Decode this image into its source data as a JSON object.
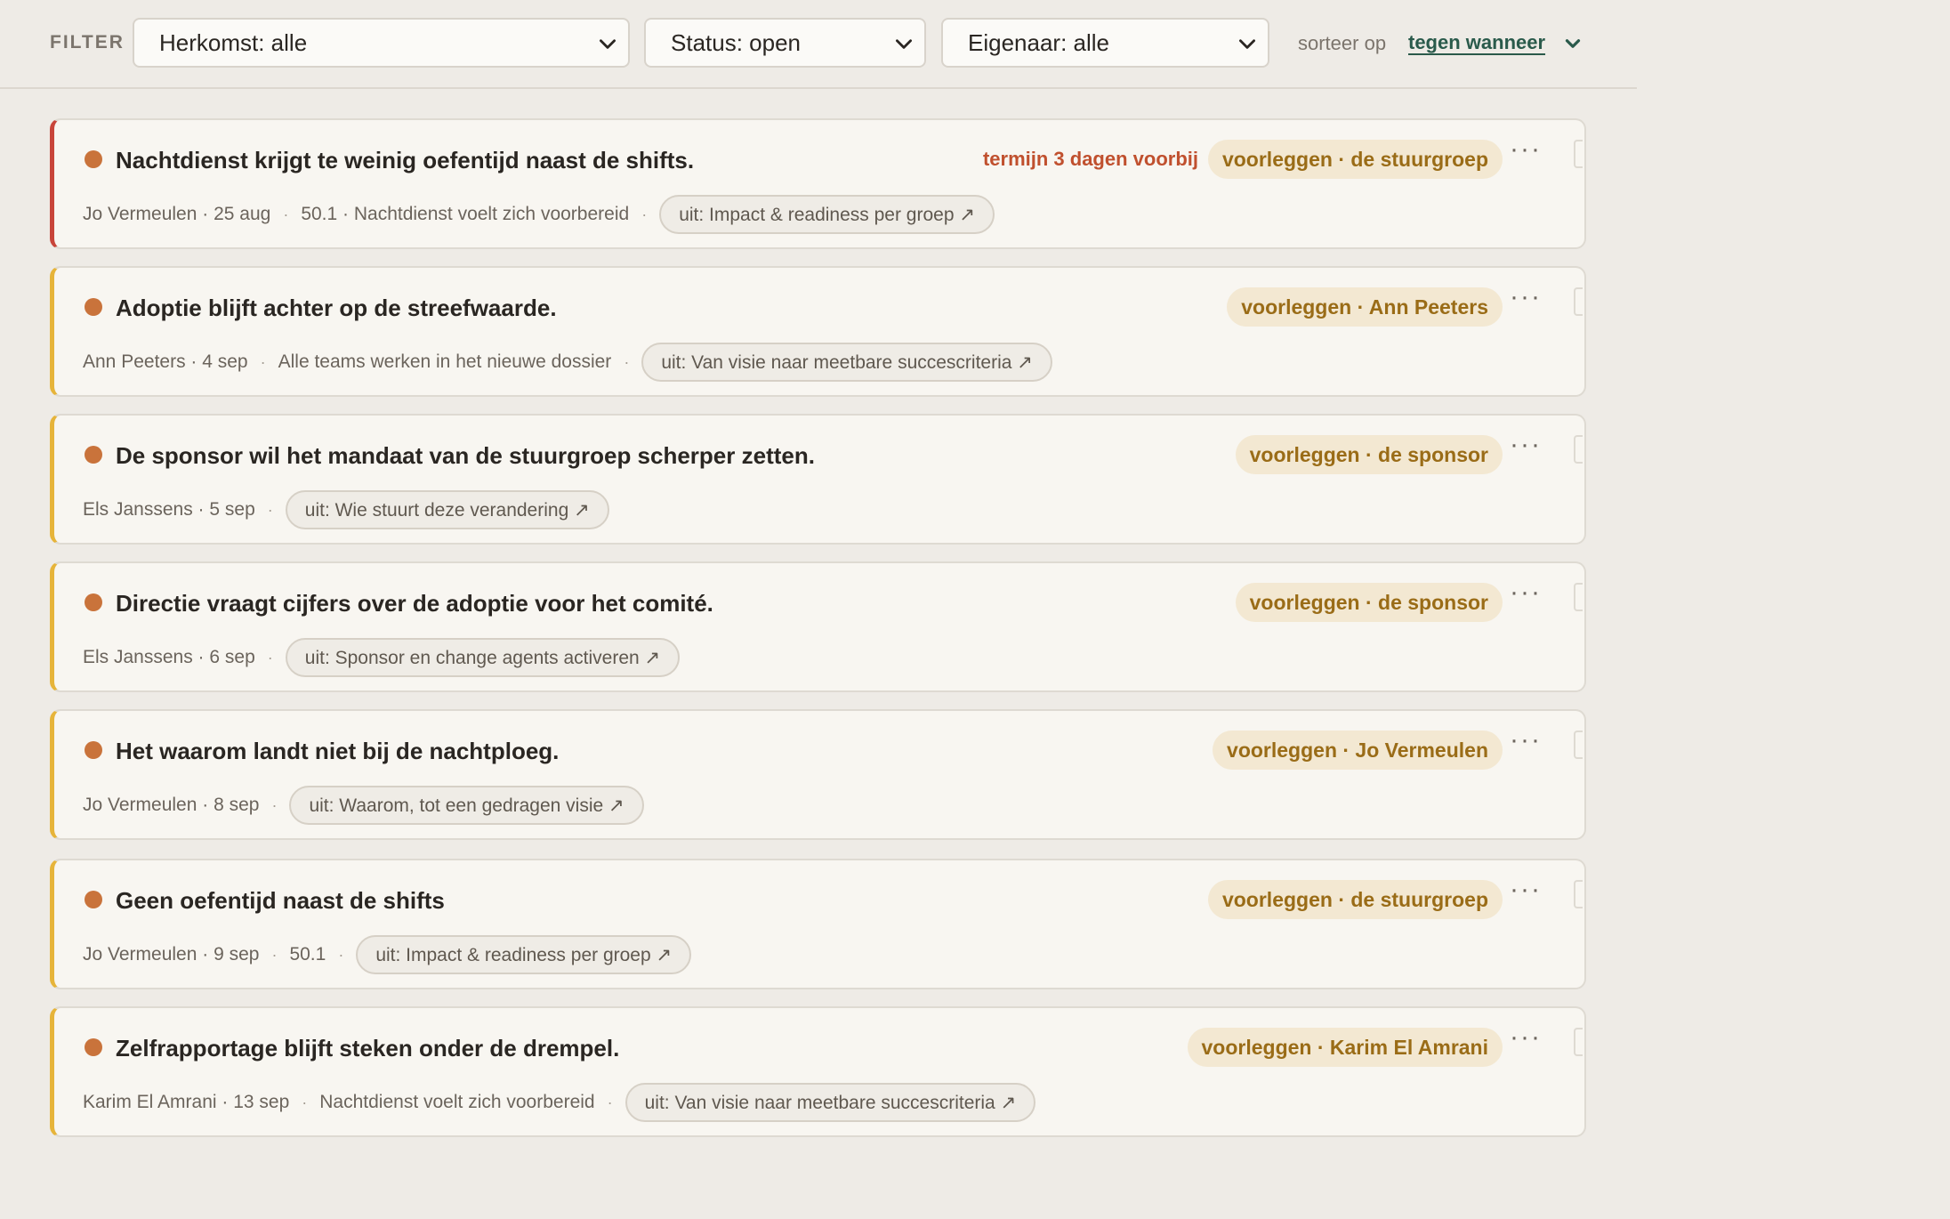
{
  "filter": {
    "label": "FILTER",
    "herkomst": "Herkomst: alle",
    "status": "Status: open",
    "eigenaar": "Eigenaar: alle",
    "sort_label": "sorteer op",
    "sort_value": "tegen wanneer"
  },
  "colors": {
    "accent_overdue": "#c8453a",
    "accent_default": "#e6b43a",
    "dot": "#c9733b",
    "pill_bg": "#f3e8d2",
    "pill_text": "#9a6c17",
    "due_text": "#c0502e",
    "link": "#2a5a4b"
  },
  "items": [
    {
      "title": "Nachtdienst krijgt te weinig oefentijd naast de shifts.",
      "due": "termijn 3 dagen voorbij",
      "pill": "voorleggen · de stuurgroep",
      "meta": "Jo Vermeulen · 25 aug",
      "extra": "50.1 · Nachtdienst voelt zich voorbereid",
      "source": "uit: Impact & readiness per groep ↗"
    },
    {
      "title": "Adoptie blijft achter op de streefwaarde.",
      "pill": "voorleggen · Ann Peeters",
      "meta": "Ann Peeters · 4 sep",
      "extra": "Alle teams werken in het nieuwe dossier",
      "source": "uit: Van visie naar meetbare succescriteria ↗"
    },
    {
      "title": "De sponsor wil het mandaat van de stuurgroep scherper zetten.",
      "pill": "voorleggen · de sponsor",
      "meta": "Els Janssens · 5 sep",
      "source": "uit: Wie stuurt deze verandering ↗"
    },
    {
      "title": "Directie vraagt cijfers over de adoptie voor het comité.",
      "pill": "voorleggen · de sponsor",
      "meta": "Els Janssens · 6 sep",
      "source": "uit: Sponsor en change agents activeren ↗"
    },
    {
      "title": "Het waarom landt niet bij de nachtploeg.",
      "pill": "voorleggen · Jo Vermeulen",
      "meta": "Jo Vermeulen · 8 sep",
      "source": "uit: Waarom, tot een gedragen visie ↗"
    },
    {
      "title": "Geen oefentijd naast de shifts",
      "pill": "voorleggen · de stuurgroep",
      "meta": "Jo Vermeulen · 9 sep",
      "extra": "50.1",
      "source": "uit: Impact & readiness per groep ↗"
    },
    {
      "title": "Zelfrapportage blijft steken onder de drempel.",
      "pill": "voorleggen · Karim El Amrani",
      "meta": "Karim El Amrani · 13 sep",
      "extra": "Nachtdienst voelt zich voorbereid",
      "source": "uit: Van visie naar meetbare succescriteria ↗"
    }
  ]
}
